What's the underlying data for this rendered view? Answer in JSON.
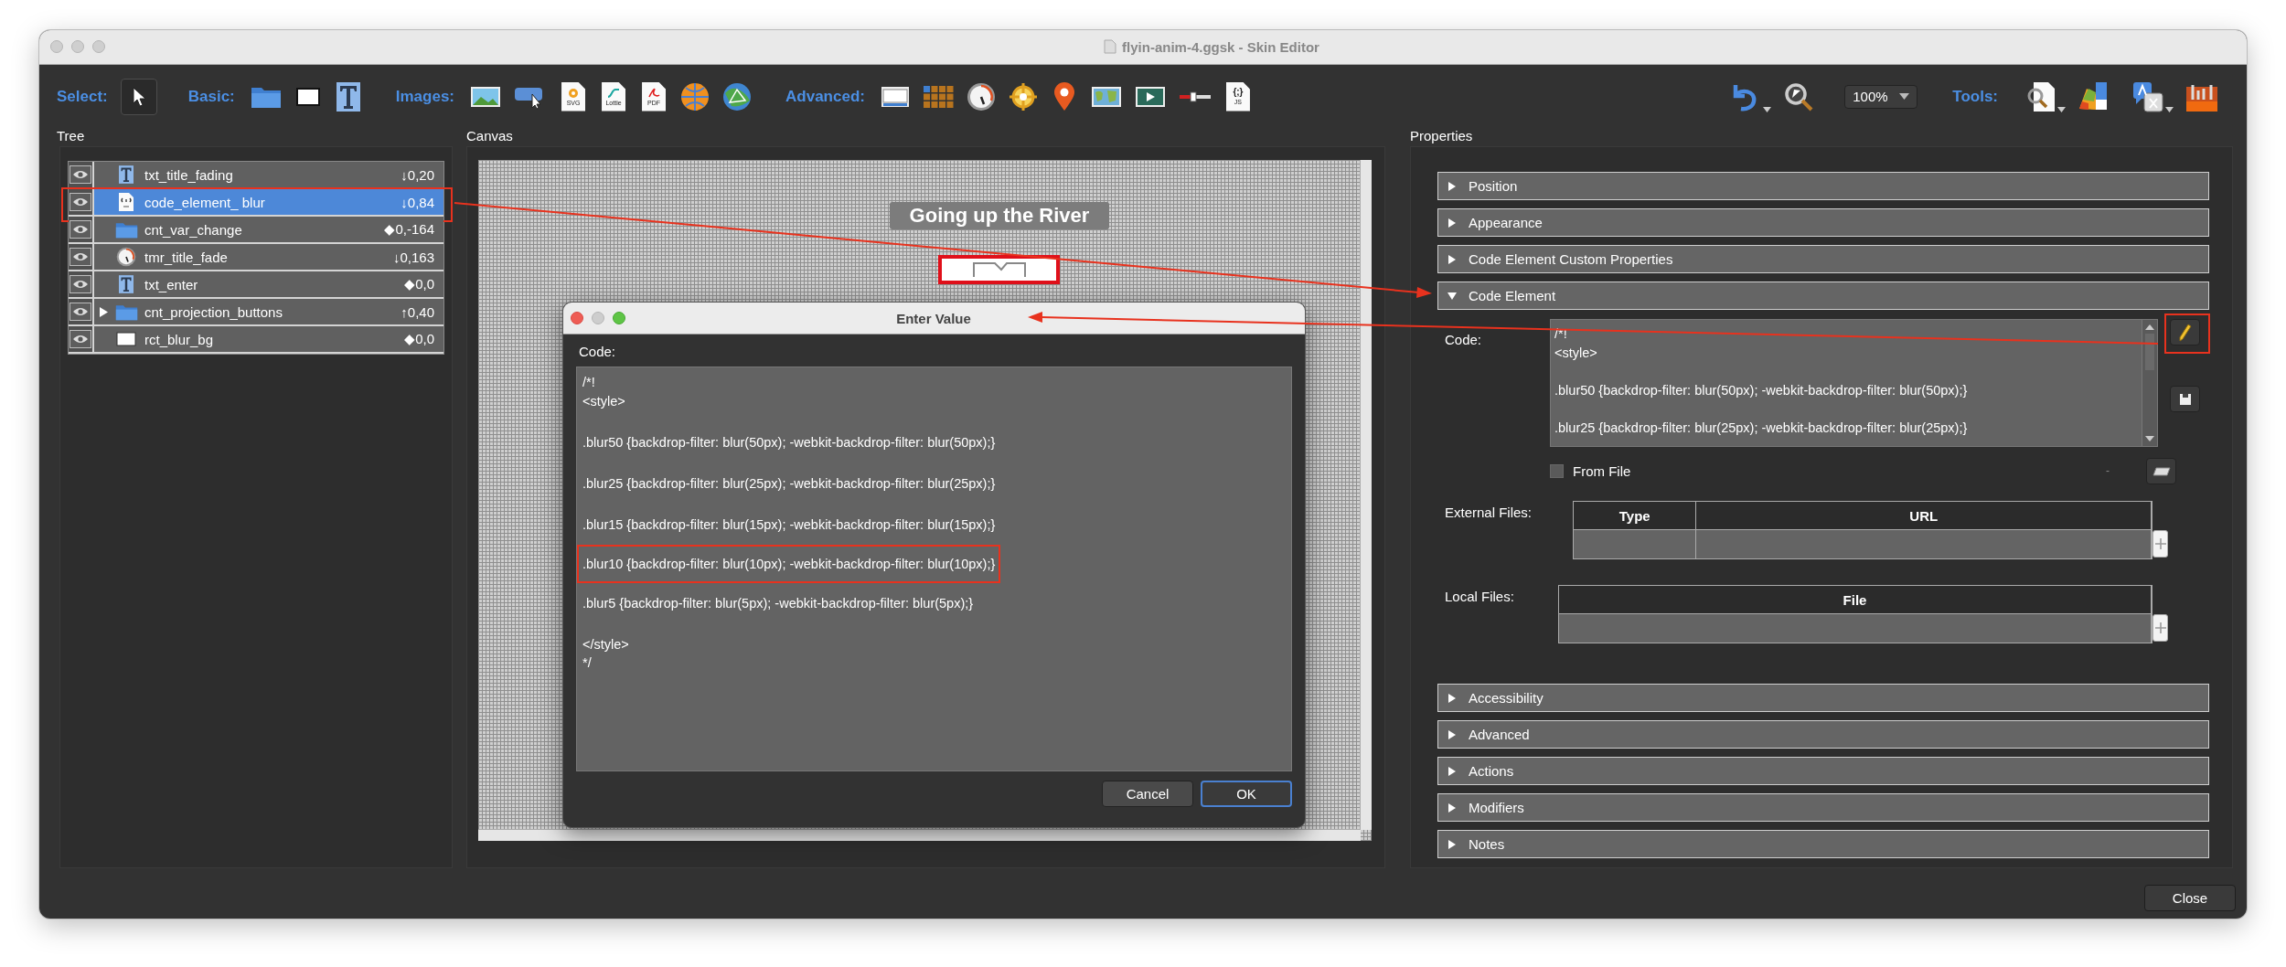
{
  "window": {
    "title": "flyin-anim-4.ggsk - Skin Editor"
  },
  "toolbar": {
    "groups": [
      {
        "label": "Select:",
        "tools": [
          {
            "kind": "pointer",
            "selected": true
          }
        ]
      },
      {
        "label": "Basic:",
        "tools": [
          {
            "kind": "folder",
            "selected": false
          },
          {
            "kind": "rectangle",
            "selected": false
          },
          {
            "kind": "text",
            "selected": false
          }
        ]
      },
      {
        "label": "Images:",
        "tools": [
          {
            "kind": "image",
            "selected": false
          },
          {
            "kind": "image-button",
            "selected": false
          },
          {
            "kind": "file",
            "badge": "SVG",
            "selected": false
          },
          {
            "kind": "file",
            "badge": "Lottie",
            "selected": false
          },
          {
            "kind": "file",
            "badge": "PDF",
            "selected": false
          },
          {
            "kind": "globe",
            "selected": false
          },
          {
            "kind": "network-globe",
            "selected": false
          }
        ]
      },
      {
        "label": "Advanced:",
        "tools": [
          {
            "kind": "window",
            "selected": false
          },
          {
            "kind": "grid",
            "selected": false
          },
          {
            "kind": "timer",
            "selected": false
          },
          {
            "kind": "crosshair",
            "selected": false
          },
          {
            "kind": "pin",
            "selected": false
          },
          {
            "kind": "map",
            "selected": false
          },
          {
            "kind": "video",
            "selected": false
          },
          {
            "kind": "slider",
            "selected": false
          },
          {
            "kind": "file",
            "badge": "JS",
            "symbol": "{;}",
            "selected": false
          }
        ]
      }
    ],
    "history": [
      {
        "kind": "undo",
        "menu": true
      },
      {
        "kind": "magnifier",
        "menu": false
      }
    ],
    "zoom": {
      "value": "100%"
    },
    "tools": {
      "label": "Tools:",
      "items": [
        {
          "kind": "document-search",
          "menu": true
        },
        {
          "kind": "palette",
          "menu": false
        },
        {
          "kind": "translate",
          "menu": true
        },
        {
          "kind": "toolbox",
          "menu": false
        }
      ]
    }
  },
  "tree": {
    "title": "Tree",
    "items": [
      {
        "name": "txt_title_fading",
        "kind": "text",
        "value": "↓0,20",
        "visible": true,
        "selected": false,
        "highlighted": false
      },
      {
        "name": "code_element_ blur",
        "kind": "code",
        "value": "↓0,84",
        "visible": true,
        "selected": true,
        "highlighted": true
      },
      {
        "name": "cnt_var_change",
        "kind": "folder",
        "value": "◆0,-164",
        "visible": true,
        "selected": false,
        "highlighted": false
      },
      {
        "name": "tmr_title_fade",
        "kind": "timer",
        "value": "↓0,163",
        "visible": true,
        "selected": false,
        "highlighted": false
      },
      {
        "name": "txt_enter",
        "kind": "text",
        "value": "◆0,0",
        "visible": true,
        "selected": false,
        "highlighted": false
      },
      {
        "name": "cnt_projection_buttons",
        "kind": "folder",
        "value": "↑0,40",
        "visible": true,
        "selected": false,
        "highlighted": false,
        "expanded": false
      },
      {
        "name": "rct_blur_bg",
        "kind": "rectangle",
        "value": "◆0,0",
        "visible": true,
        "selected": false,
        "highlighted": false
      }
    ]
  },
  "canvas": {
    "title": "Canvas",
    "heading": "Going up the River"
  },
  "dialog": {
    "title": "Enter Value",
    "code_label": "Code:",
    "blocks": [
      {
        "text": "/*!\n<style>",
        "highlighted": false
      },
      {
        "text": ".blur50 {backdrop-filter: blur(50px); -webkit-backdrop-filter: blur(50px);}",
        "highlighted": false
      },
      {
        "text": ".blur25 {backdrop-filter: blur(25px); -webkit-backdrop-filter: blur(25px);}",
        "highlighted": false
      },
      {
        "text": ".blur15 {backdrop-filter: blur(15px); -webkit-backdrop-filter: blur(15px);}",
        "highlighted": false
      },
      {
        "text": ".blur10 {backdrop-filter: blur(10px); -webkit-backdrop-filter: blur(10px);}",
        "highlighted": true
      },
      {
        "text": ".blur5 {backdrop-filter: blur(5px); -webkit-backdrop-filter: blur(5px);}",
        "highlighted": false
      },
      {
        "text": "</style>\n*/",
        "highlighted": false
      }
    ],
    "buttons": [
      {
        "label": "Cancel",
        "default": false
      },
      {
        "label": "OK",
        "default": true
      }
    ]
  },
  "properties": {
    "title": "Properties",
    "sections": [
      {
        "label": "Position",
        "expanded": false
      },
      {
        "label": "Appearance",
        "expanded": false
      },
      {
        "label": "Code Element Custom Properties",
        "expanded": false
      },
      {
        "label": "Code Element",
        "expanded": true,
        "content": {
          "code_label": "Code:",
          "code_blocks": [
            "/*!\n<style>",
            ".blur50 {backdrop-filter: blur(50px); -webkit-backdrop-filter: blur(50px);}",
            ".blur25 {backdrop-filter: blur(25px); -webkit-backdrop-filter: blur(25px);}"
          ],
          "edit_highlighted": true,
          "from_file": {
            "label": "From File",
            "checked": false
          },
          "file_name": "-",
          "external_files": {
            "label": "External Files:",
            "columns": [
              "Type",
              "URL"
            ]
          },
          "local_files": {
            "label": "Local Files:",
            "columns": [
              "File"
            ]
          }
        }
      },
      {
        "label": "Accessibility",
        "expanded": false
      },
      {
        "label": "Advanced",
        "expanded": false
      },
      {
        "label": "Actions",
        "expanded": false
      },
      {
        "label": "Modifiers",
        "expanded": false
      },
      {
        "label": "Notes",
        "expanded": false
      }
    ]
  },
  "footer": {
    "close": "Close"
  }
}
